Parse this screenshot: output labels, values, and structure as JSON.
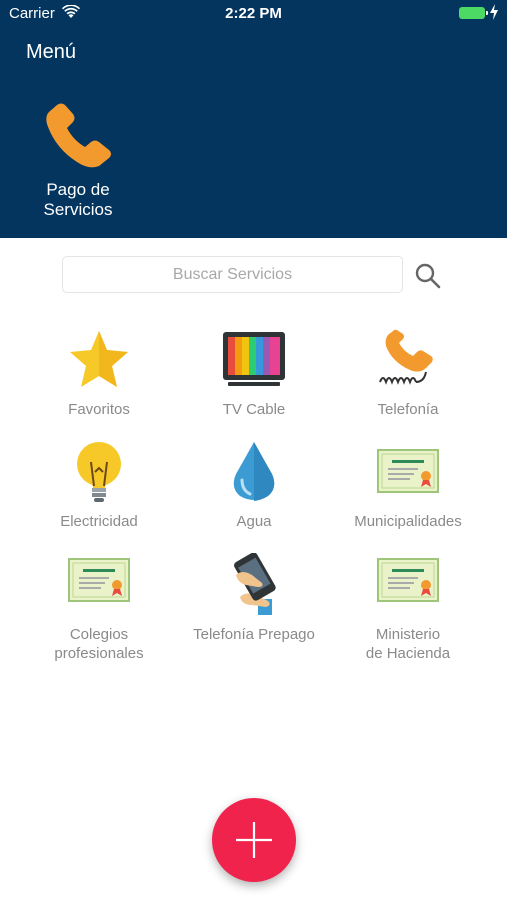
{
  "status_bar": {
    "carrier": "Carrier",
    "time": "2:22 PM"
  },
  "header": {
    "title": "Menú",
    "tile": {
      "label_line1": "Pago de",
      "label_line2": "Servicios",
      "icon": "phone-icon"
    }
  },
  "search": {
    "placeholder": "Buscar Servicios",
    "value": ""
  },
  "services": [
    {
      "line1": "Favoritos",
      "line2": "",
      "icon": "star-icon"
    },
    {
      "line1": "TV Cable",
      "line2": "",
      "icon": "tv-icon"
    },
    {
      "line1": "Telefonía",
      "line2": "",
      "icon": "telephone-icon"
    },
    {
      "line1": "Electricidad",
      "line2": "",
      "icon": "lightbulb-icon"
    },
    {
      "line1": "Agua",
      "line2": "",
      "icon": "water-drop-icon"
    },
    {
      "line1": "Municipalidades",
      "line2": "",
      "icon": "certificate-icon"
    },
    {
      "line1": "Colegios",
      "line2": "profesionales",
      "icon": "certificate-icon"
    },
    {
      "line1": "Telefonía Prepago",
      "line2": "",
      "icon": "mobile-phone-icon"
    },
    {
      "line1": "Ministerio",
      "line2": "de Hacienda",
      "icon": "certificate-icon"
    }
  ],
  "fab": {
    "icon": "plus-icon"
  },
  "colors": {
    "header_bg": "#04355f",
    "accent_orange": "#f39a2e",
    "fab": "#f0234d",
    "label_gray": "#8a8a8a"
  }
}
